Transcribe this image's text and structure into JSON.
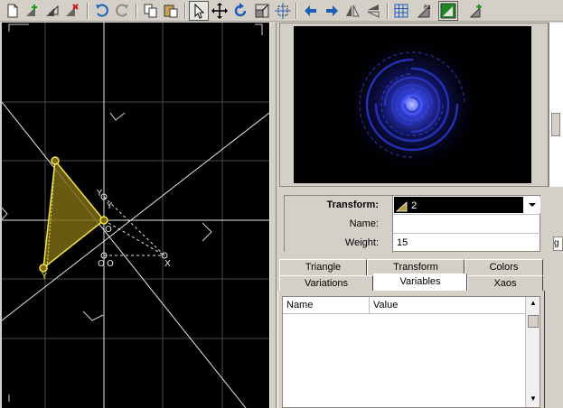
{
  "toolbar": {
    "buttons": [
      "new-icon",
      "add-icon",
      "duplicate-icon",
      "delete-icon",
      "undo-icon",
      "redo-icon",
      "copy-icon",
      "paste-icon",
      "select-icon",
      "move-icon",
      "rotate-icon",
      "scale-icon",
      "pivot-icon",
      "flip-left-icon",
      "flip-right-icon",
      "flip-vertical-icon",
      "flip-horizontal-icon",
      "grid-icon",
      "post-transform-icon",
      "final-transform-icon",
      "reset-icon"
    ],
    "pressed": [
      "select-icon",
      "final-transform-icon"
    ]
  },
  "editor": {
    "labels": {
      "x": "X",
      "y": "Y",
      "o": "O",
      "y_ref": "Y",
      "o_ref": "O",
      "o_left": "O",
      "y_top_small": "Y",
      "y_bottom": "Y"
    },
    "colors": {
      "background": "#000000",
      "grid": "#4a4a4a",
      "axis": "#e0e0e0",
      "triangle_fill": "#7a6a14",
      "triangle_stroke": "#f2e34a"
    }
  },
  "properties": {
    "transform_label": "Transform:",
    "transform_value": "2",
    "name_label": "Name:",
    "name_value": "",
    "weight_label": "Weight:",
    "weight_value": "15"
  },
  "side_box_text": "g",
  "tabs": {
    "row1": [
      "Triangle",
      "Transform",
      "Colors"
    ],
    "row2": [
      "Variations",
      "Variables",
      "Xaos"
    ],
    "active": "Variables"
  },
  "variables_list": {
    "columns": [
      "Name",
      "Value"
    ],
    "rows": []
  }
}
